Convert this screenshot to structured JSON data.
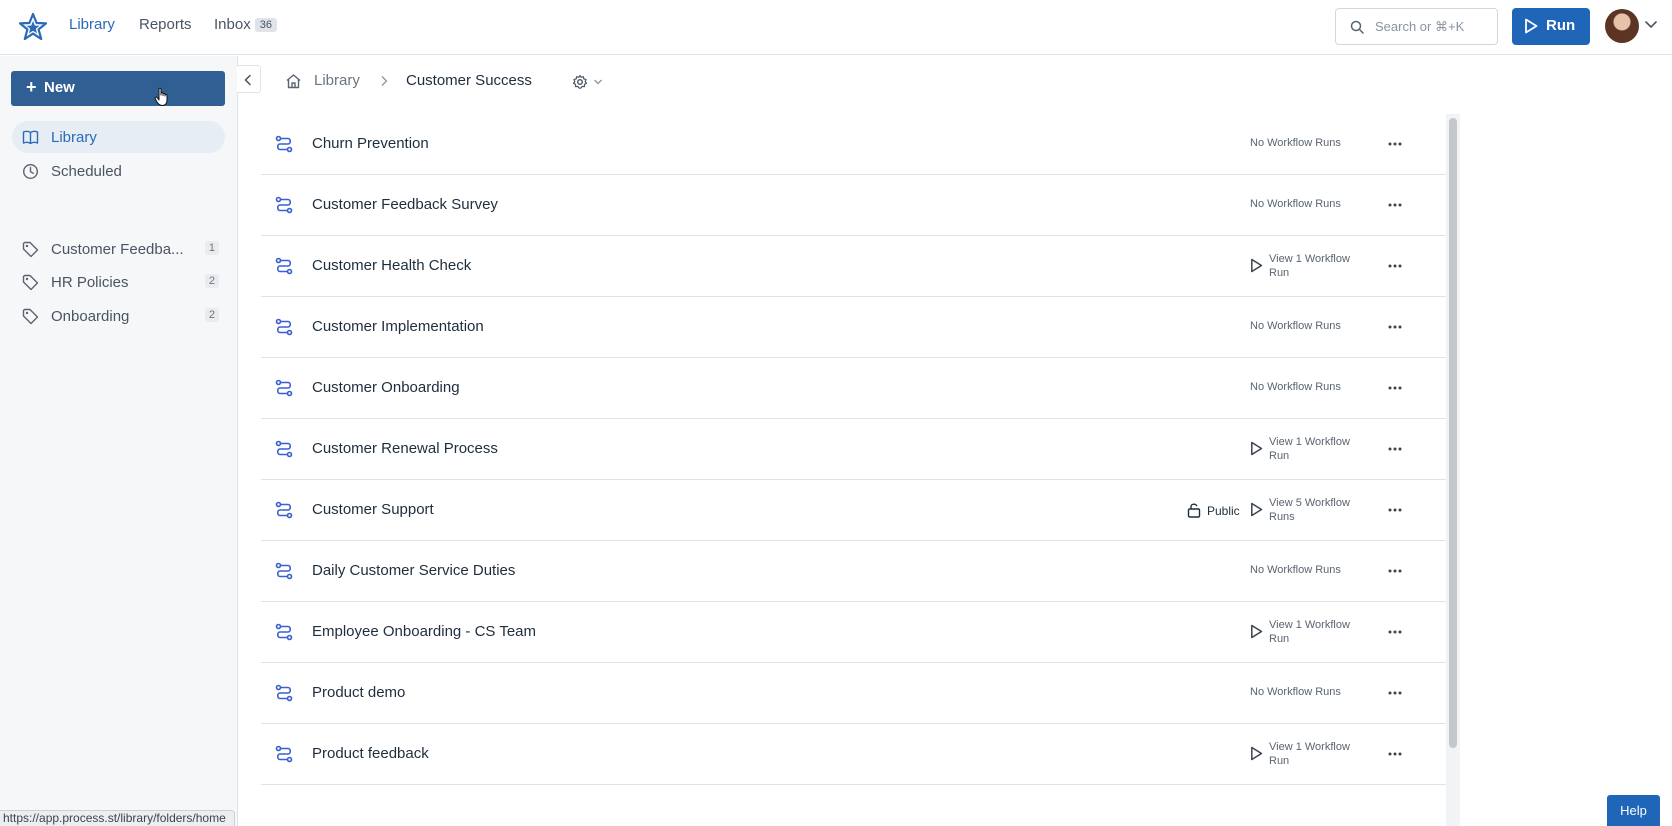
{
  "nav": {
    "items": [
      {
        "label": "Library",
        "active": true
      },
      {
        "label": "Reports",
        "active": false
      },
      {
        "label": "Inbox",
        "active": false
      }
    ],
    "inbox_count": "36",
    "search_placeholder": "Search or ⌘+K",
    "run_label": "Run"
  },
  "sidebar": {
    "new_label": "New",
    "items": [
      {
        "label": "Library",
        "icon": "book-icon",
        "active": true
      },
      {
        "label": "Scheduled",
        "icon": "clock-icon",
        "active": false
      }
    ],
    "tags": [
      {
        "label": "Customer Feedba...",
        "count": "1"
      },
      {
        "label": "HR Policies",
        "count": "2"
      },
      {
        "label": "Onboarding",
        "count": "2"
      }
    ]
  },
  "breadcrumb": {
    "root": "Library",
    "current": "Customer Success"
  },
  "workflows": [
    {
      "title": "Churn Prevention",
      "runs": "No Workflow Runs",
      "has_runs": false,
      "public": false
    },
    {
      "title": "Customer Feedback Survey",
      "runs": "No Workflow Runs",
      "has_runs": false,
      "public": false
    },
    {
      "title": "Customer Health Check",
      "runs": "View 1 Workflow Run",
      "has_runs": true,
      "public": false
    },
    {
      "title": "Customer Implementation",
      "runs": "No Workflow Runs",
      "has_runs": false,
      "public": false
    },
    {
      "title": "Customer Onboarding",
      "runs": "No Workflow Runs",
      "has_runs": false,
      "public": false
    },
    {
      "title": "Customer Renewal Process",
      "runs": "View 1 Workflow Run",
      "has_runs": true,
      "public": false
    },
    {
      "title": "Customer Support",
      "runs": "View 5 Workflow Runs",
      "has_runs": true,
      "public": true
    },
    {
      "title": "Daily Customer Service Duties",
      "runs": "No Workflow Runs",
      "has_runs": false,
      "public": false
    },
    {
      "title": "Employee Onboarding - CS Team",
      "runs": "View 1 Workflow Run",
      "has_runs": true,
      "public": false
    },
    {
      "title": "Product demo",
      "runs": "No Workflow Runs",
      "has_runs": false,
      "public": false
    },
    {
      "title": "Product feedback",
      "runs": "View 1 Workflow Run",
      "has_runs": true,
      "public": false
    }
  ],
  "public_label": "Public",
  "status_url": "https://app.process.st/library/folders/home",
  "help_label": "Help",
  "colors": {
    "accent": "#1f66b8",
    "new_button": "#2f5f93",
    "icon": "#3a5fcf"
  }
}
